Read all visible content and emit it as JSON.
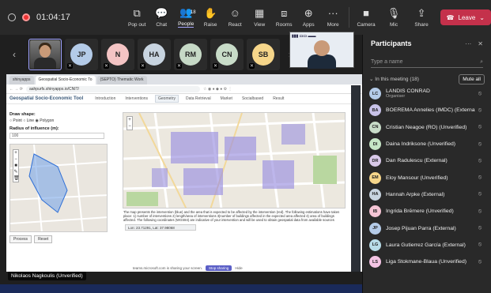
{
  "meeting": {
    "timer": "01:04:17",
    "controls": [
      {
        "name": "pop-out",
        "label": "Pop out",
        "icon": "⧉"
      },
      {
        "name": "chat",
        "label": "Chat",
        "icon": "💬"
      },
      {
        "name": "people",
        "label": "People",
        "icon": "👥",
        "badge": "18"
      },
      {
        "name": "raise",
        "label": "Raise",
        "icon": "✋"
      },
      {
        "name": "react",
        "label": "React",
        "icon": "☺"
      },
      {
        "name": "view",
        "label": "View",
        "icon": "▦"
      },
      {
        "name": "rooms",
        "label": "Rooms",
        "icon": "⧈"
      },
      {
        "name": "apps",
        "label": "Apps",
        "icon": "⊕"
      },
      {
        "name": "more",
        "label": "More",
        "icon": "···"
      }
    ],
    "device_controls": [
      {
        "name": "camera",
        "label": "Camera",
        "icon": "■"
      },
      {
        "name": "mic",
        "label": "Mic",
        "icon": "🎙"
      },
      {
        "name": "share",
        "label": "Share",
        "icon": "⇪"
      }
    ],
    "leave_label": "Leave"
  },
  "strip": {
    "tiles": [
      {
        "initials": "JP",
        "color": "#b4cbe8"
      },
      {
        "initials": "N",
        "color": "#f4c4c4"
      },
      {
        "initials": "HA",
        "color": "#c8d4e0"
      },
      {
        "initials": "RM",
        "color": "#c6d9c6"
      },
      {
        "initials": "CN",
        "color": "#c8dcc8"
      },
      {
        "initials": "SB",
        "color": "#f6d68a"
      }
    ]
  },
  "shared": {
    "browser_tabs": [
      "shinyapps",
      "Geospatial Socio-Economic To",
      "(SEPTO) Thematic Work"
    ],
    "url": "aahpurfs.shinyapps.io/CNIT/",
    "app_title": "Geospatial Socio-Economic Tool",
    "nav": [
      "Introduction",
      "Interventions",
      "Geometry",
      "Data Retrieval",
      "Market",
      "Socialbased",
      "Result"
    ],
    "active_nav": "Geometry",
    "draw_shape_label": "Draw shape:",
    "shape_options": "○ Point  ○ Line  ◉ Polygon",
    "radius_label": "Radius of influence (m):",
    "radius_value": "100",
    "process_label": "Process",
    "reset_label": "Reset",
    "caption": "The map presents the intervention (blue) and the area that is expected to be affected by the intervention (red). The following estimations have taken place: 1) number of interventions 2) length/area of interventions 3)number of buildings affected in the expected area affected 4) area of buildings affected. The following coordinates (WGS84) are indicative of your intervention and will be used to obtain geospatial data from available sources",
    "coords": "Lon: 23.71291, Lat: 37.98068",
    "sharing_text": "teams.microsoft.com is sharing your screen.",
    "stop_label": "Stop sharing",
    "hide_label": "Hide",
    "presenter": "Nikolaos Nagkoulis (Unverified)"
  },
  "panel": {
    "title": "Participants",
    "search_placeholder": "Type a name",
    "section_label": "In this meeting (18)",
    "mute_all": "Mute all",
    "people": [
      {
        "initials": "LC",
        "name": "LANDIS CONRAD",
        "sub": "Organiser",
        "color": "#b4cbe8"
      },
      {
        "initials": "BA",
        "name": "BOEREMA Annelies (IMDC) (External)",
        "sub": "",
        "color": "#c8c2e8"
      },
      {
        "initials": "CN",
        "name": "Cristian Neagoe (RO) (Unverified)",
        "sub": "",
        "color": "#c8dcc8"
      },
      {
        "initials": "DI",
        "name": "Daina Indriksone (Unverified)",
        "sub": "",
        "color": "#c6e6c6"
      },
      {
        "initials": "DR",
        "name": "Dan Radulescu (External)",
        "sub": "",
        "color": "#d8c8e8"
      },
      {
        "initials": "EM",
        "name": "Eloy Mansour (Unverified)",
        "sub": "",
        "color": "#f6d68a"
      },
      {
        "initials": "HA",
        "name": "Hannah Arpke (External)",
        "sub": "",
        "color": "#c8d4e0"
      },
      {
        "initials": "IB",
        "name": "Ingrida Brēmere (Unverified)",
        "sub": "",
        "color": "#f4c4d4"
      },
      {
        "initials": "JP",
        "name": "Josep Pijuan Parra (External)",
        "sub": "",
        "color": "#b4cbe8"
      },
      {
        "initials": "LG",
        "name": "Laura Gutierrez García (External)",
        "sub": "",
        "color": "#b8dce8"
      },
      {
        "initials": "LS",
        "name": "Liga Stokmane-Blaua (Unverified)",
        "sub": "",
        "color": "#f4c4e4"
      }
    ]
  }
}
